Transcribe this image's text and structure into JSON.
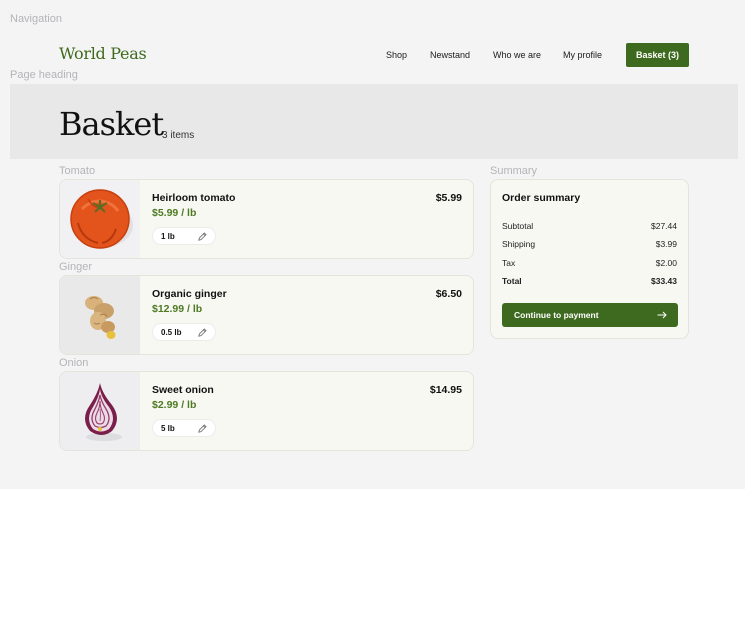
{
  "labels": {
    "navigation": "Navigation",
    "page_heading": "Page heading",
    "tomato": "Tomato",
    "ginger": "Ginger",
    "onion": "Onion",
    "summary": "Summary"
  },
  "nav": {
    "logo": "World Peas",
    "links": [
      "Shop",
      "Newstand",
      "Who we are",
      "My profile"
    ],
    "basket_button": "Basket (3)"
  },
  "heading": {
    "title": "Basket",
    "count": "3 items"
  },
  "items": [
    {
      "name": "Heirloom tomato",
      "unit_price": "$5.99 / lb",
      "price": "$5.99",
      "quantity": "1 lb",
      "icon": "tomato-image"
    },
    {
      "name": "Organic ginger",
      "unit_price": "$12.99 / lb",
      "price": "$6.50",
      "quantity": "0.5 lb",
      "icon": "ginger-image"
    },
    {
      "name": "Sweet onion",
      "unit_price": "$2.99 / lb",
      "price": "$14.95",
      "quantity": "5 lb",
      "icon": "onion-image"
    }
  ],
  "summary": {
    "title": "Order summary",
    "rows": [
      {
        "label": "Subtotal",
        "value": "$27.44"
      },
      {
        "label": "Shipping",
        "value": "$3.99"
      },
      {
        "label": "Tax",
        "value": "$2.00"
      },
      {
        "label": "Total",
        "value": "$33.43"
      }
    ],
    "button": "Continue to payment"
  },
  "colors": {
    "brand_green": "#3e6a1f",
    "price_green": "#4d7a22",
    "card_bg": "#f8f8f3",
    "page_bg": "#f4f4f5"
  }
}
